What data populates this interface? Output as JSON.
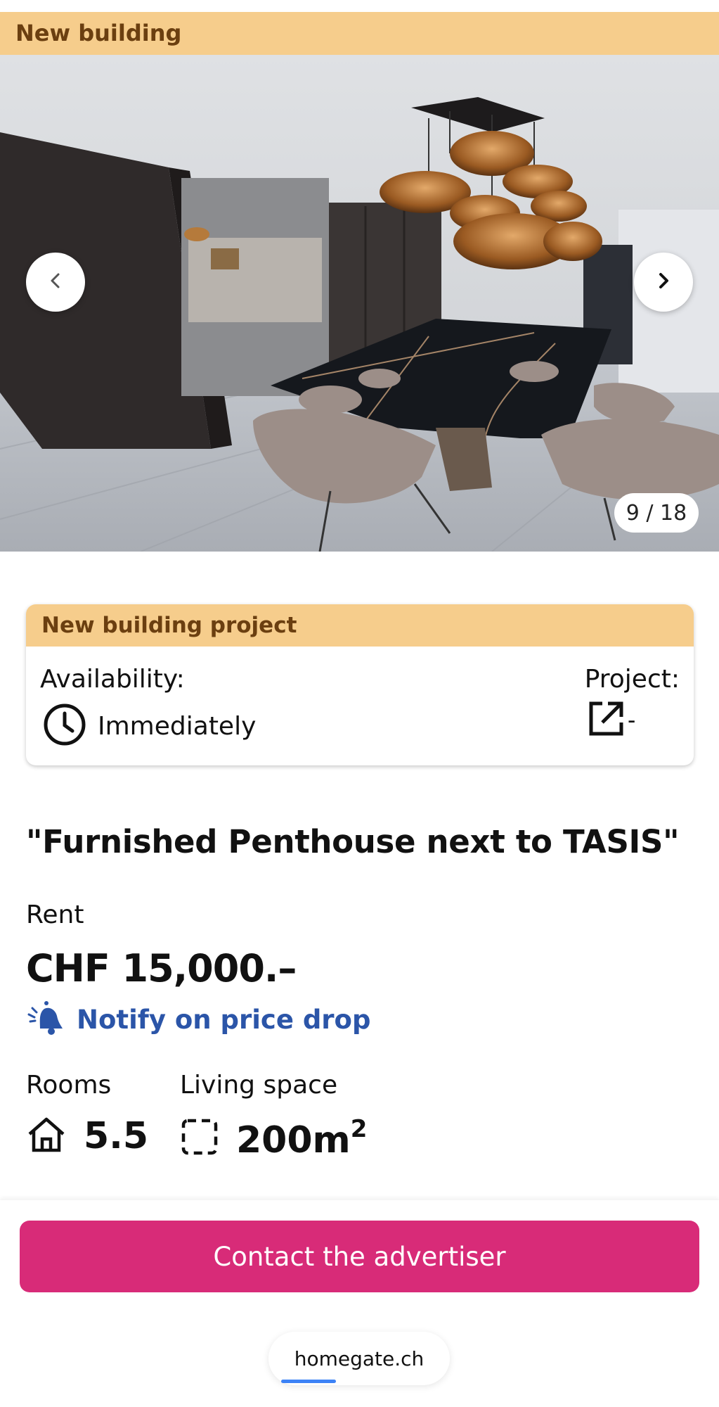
{
  "banner": {
    "label": "New building"
  },
  "gallery": {
    "counter": "9 / 18",
    "prev_icon": "chevron-left-icon",
    "next_icon": "chevron-right-icon"
  },
  "project_card": {
    "header": "New building project",
    "availability_label": "Availability:",
    "availability_value": "Immediately",
    "availability_icon": "clock-icon",
    "project_label": "Project:",
    "project_value": "-",
    "project_icon": "external-link-icon"
  },
  "listing": {
    "title": "\"Furnished Penthouse next to TASIS\"",
    "rent_label": "Rent",
    "price": "CHF 15,000.–",
    "notify_label": "Notify on price drop",
    "notify_icon": "bell-icon"
  },
  "facts": {
    "rooms_label": "Rooms",
    "rooms_value": "5.5",
    "rooms_icon": "house-icon",
    "space_label": "Living space",
    "space_value": "200m",
    "space_unit_sup": "2",
    "space_icon": "area-icon"
  },
  "actions": {
    "contact_label": "Contact the advertiser"
  },
  "browser": {
    "url": "homegate.ch"
  },
  "colors": {
    "banner_bg": "#f6cd8c",
    "banner_text": "#6b3f10",
    "accent_pink": "#d82b78",
    "link_blue": "#2b55a8"
  }
}
